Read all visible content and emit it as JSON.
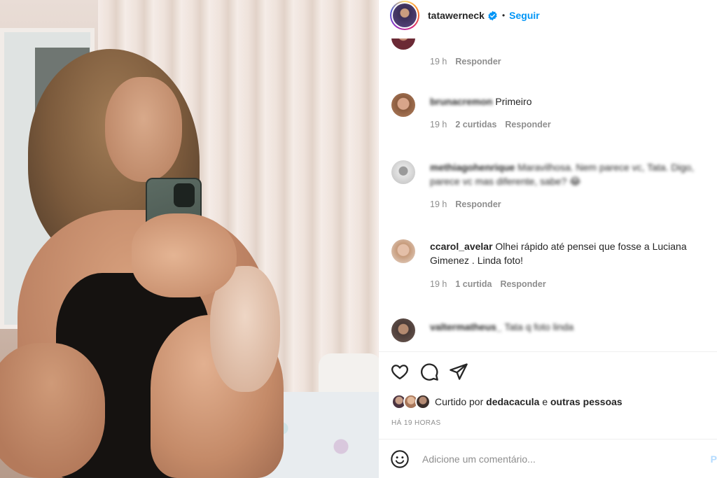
{
  "post": {
    "username": "tatawerneck",
    "separator": "•",
    "follow_label": "Seguir",
    "verified_icon": "verified-badge-icon"
  },
  "comments": [
    {
      "user": "",
      "text": "",
      "time": "19 h",
      "likes": "",
      "reply": "Responder",
      "blurred": true
    },
    {
      "user": "brunacremon",
      "text": "Primeiro",
      "time": "19 h",
      "likes": "2 curtidas",
      "reply": "Responder",
      "blurred": true
    },
    {
      "user": "methiagohenrique",
      "text": "Maravilhosa. Nem parece vc, Tata. Digo, parece vc mas diferente, sabe? 😂",
      "time": "19 h",
      "likes": "",
      "reply": "Responder",
      "blurred": true
    },
    {
      "user": "ccarol_avelar",
      "text": "Olhei rápido até pensei que fosse a Luciana Gimenez . Linda foto!",
      "time": "19 h",
      "likes": "1 curtida",
      "reply": "Responder",
      "blurred": false
    },
    {
      "user": "valtermatheus_",
      "text": "Tata q foto linda",
      "time": "",
      "likes": "",
      "reply": "",
      "blurred": true
    }
  ],
  "actions": {
    "like_icon": "heart-icon",
    "comment_icon": "comment-icon",
    "share_icon": "send-icon"
  },
  "likes": {
    "prefix": "Curtido por",
    "user": "dedacacula",
    "conj": "e",
    "others": "outras pessoas"
  },
  "time_ago": "HÁ 19 HORAS",
  "add_comment": {
    "placeholder": "Adicione um comentário...",
    "emoji_icon": "emoji-icon",
    "publish_label": "P"
  },
  "colors": {
    "link_blue": "#0095f6",
    "muted": "#8e8e8e",
    "text": "#262626",
    "publish_disabled": "#b3dbff"
  }
}
